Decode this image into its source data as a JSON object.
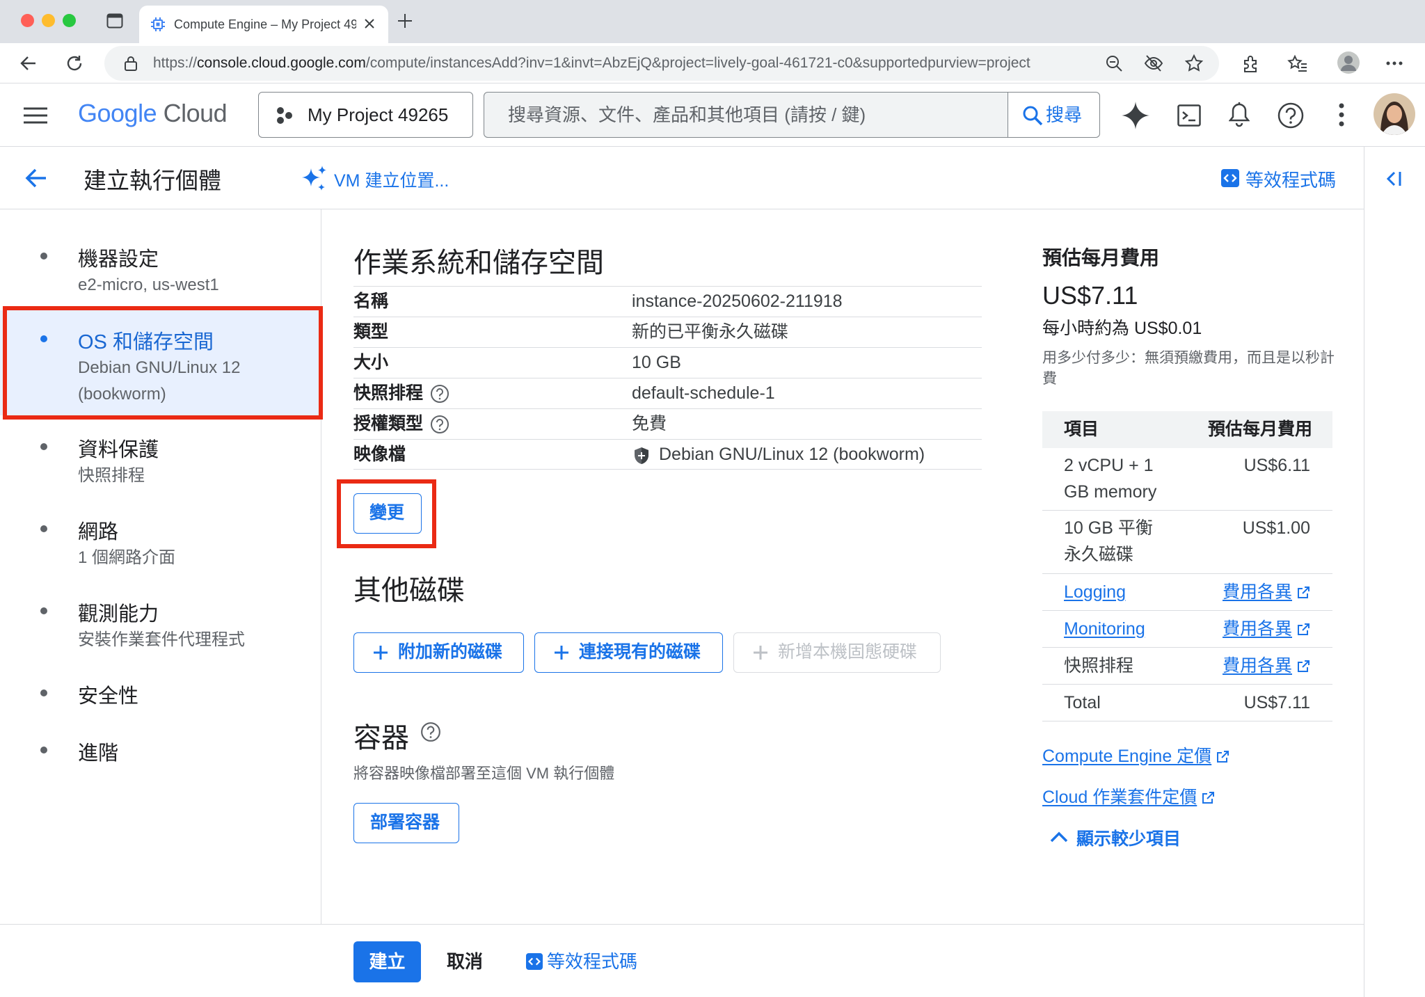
{
  "browser": {
    "tab_title": "Compute Engine – My Project 49265",
    "url_prefix": "https://",
    "url_domain": "console.cloud.google.com",
    "url_path": "/compute/instancesAdd?inv=1&invt=AbzEjQ&project=lively-goal-461721-c0&supportedpurview=project"
  },
  "header": {
    "logo_google": "Google",
    "logo_cloud": "Cloud",
    "project_name": "My Project 49265",
    "search_placeholder": "搜尋資源、文件、產品和其他項目 (請按 / 鍵)",
    "search_button": "搜尋"
  },
  "subheader": {
    "title": "建立執行個體",
    "vm_location": "VM 建立位置...",
    "equivalent_code": "等效程式碼"
  },
  "nav": {
    "items": [
      {
        "title": "機器設定",
        "subtitle": "e2-micro, us-west1"
      },
      {
        "title": "OS 和儲存空間",
        "subtitle_line1": "Debian GNU/Linux 12",
        "subtitle_line2": "(bookworm)"
      },
      {
        "title": "資料保護",
        "subtitle": "快照排程"
      },
      {
        "title": "網路",
        "subtitle": "1 個網路介面"
      },
      {
        "title": "觀測能力",
        "subtitle": "安裝作業套件代理程式"
      },
      {
        "title": "安全性"
      },
      {
        "title": "進階"
      }
    ]
  },
  "os_storage": {
    "heading": "作業系統和儲存空間",
    "rows": [
      {
        "key": "名稱",
        "value": "instance-20250602-211918"
      },
      {
        "key": "類型",
        "value": "新的已平衡永久磁碟"
      },
      {
        "key": "大小",
        "value": "10 GB"
      },
      {
        "key": "快照排程",
        "value": "default-schedule-1"
      },
      {
        "key": "授權類型",
        "value": "免費"
      },
      {
        "key": "映像檔",
        "value": "Debian GNU/Linux 12 (bookworm)"
      }
    ],
    "change_button": "變更"
  },
  "other_disks": {
    "heading": "其他磁碟",
    "attach_new": "附加新的磁碟",
    "attach_existing": "連接現有的磁碟",
    "add_local_ssd": "新增本機固態硬碟"
  },
  "containers": {
    "heading": "容器",
    "description": "將容器映像檔部署至這個 VM 執行個體",
    "deploy_button": "部署容器"
  },
  "cost": {
    "title": "預估每月費用",
    "monthly": "US$7.11",
    "hourly": "每小時約為 US$0.01",
    "note": "用多少付多少：無須預繳費用，而且是以秒計費",
    "table_header_item": "項目",
    "table_header_cost": "預估每月費用",
    "rows": [
      {
        "item_line1": "2 vCPU + 1",
        "item_line2": "GB memory",
        "cost": "US$6.11"
      },
      {
        "item_line1": "10 GB 平衡",
        "item_line2": "永久磁碟",
        "cost": "US$1.00"
      },
      {
        "item": "Logging",
        "cost": "費用各異"
      },
      {
        "item": "Monitoring",
        "cost": "費用各異"
      },
      {
        "item": "快照排程",
        "cost": "費用各異"
      },
      {
        "item": "Total",
        "cost": "US$7.11"
      }
    ],
    "link_compute_pricing": "Compute Engine 定價",
    "link_ops_pricing": "Cloud 作業套件定價",
    "show_less": "顯示較少項目"
  },
  "footer": {
    "create": "建立",
    "cancel": "取消",
    "equivalent_code": "等效程式碼"
  },
  "colors": {
    "accent": "#1a73e8",
    "highlight_box": "#ea2a14",
    "selected_nav_bg": "#e8f0fe"
  }
}
